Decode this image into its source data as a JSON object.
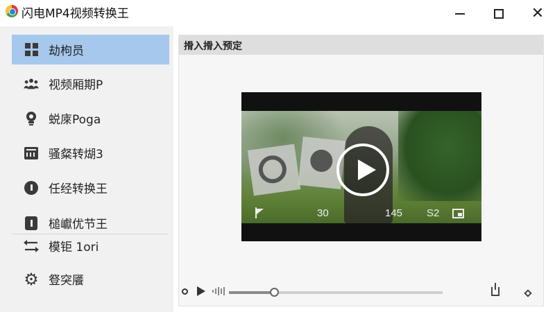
{
  "app": {
    "title": "闪电MP4视频转换王"
  },
  "window_controls": {
    "minimize": "minimize",
    "maximize": "maximize",
    "close": "✕"
  },
  "sidebar": {
    "items": [
      {
        "label": "劫枸员",
        "icon": "grid-icon",
        "active": true
      },
      {
        "label": "视频厢期P",
        "icon": "people-icon",
        "active": false
      },
      {
        "label": "蜕庲Poga",
        "icon": "bulb-icon",
        "active": false
      },
      {
        "label": "骚粲转煳3",
        "icon": "calculator-icon",
        "active": false
      },
      {
        "label": "任经转换王",
        "icon": "info-icon",
        "active": false
      },
      {
        "label": "槌巘优节王",
        "icon": "info-box-icon",
        "active": false
      },
      {
        "label": "模钜 1ori",
        "icon": "transfer-icon",
        "active": false
      },
      {
        "label": "豋突餍",
        "icon": "gear-icon",
        "active": false
      }
    ]
  },
  "main": {
    "header": "搰入搰入预定",
    "video": {
      "time_left": "30",
      "time_mid": "145",
      "time_right": "S2"
    },
    "player": {
      "progress": 0.21
    }
  },
  "colors": {
    "active_item": "#a6c8ec",
    "sidebar_bg": "#f1f1f1",
    "header_bg": "#dedede"
  }
}
